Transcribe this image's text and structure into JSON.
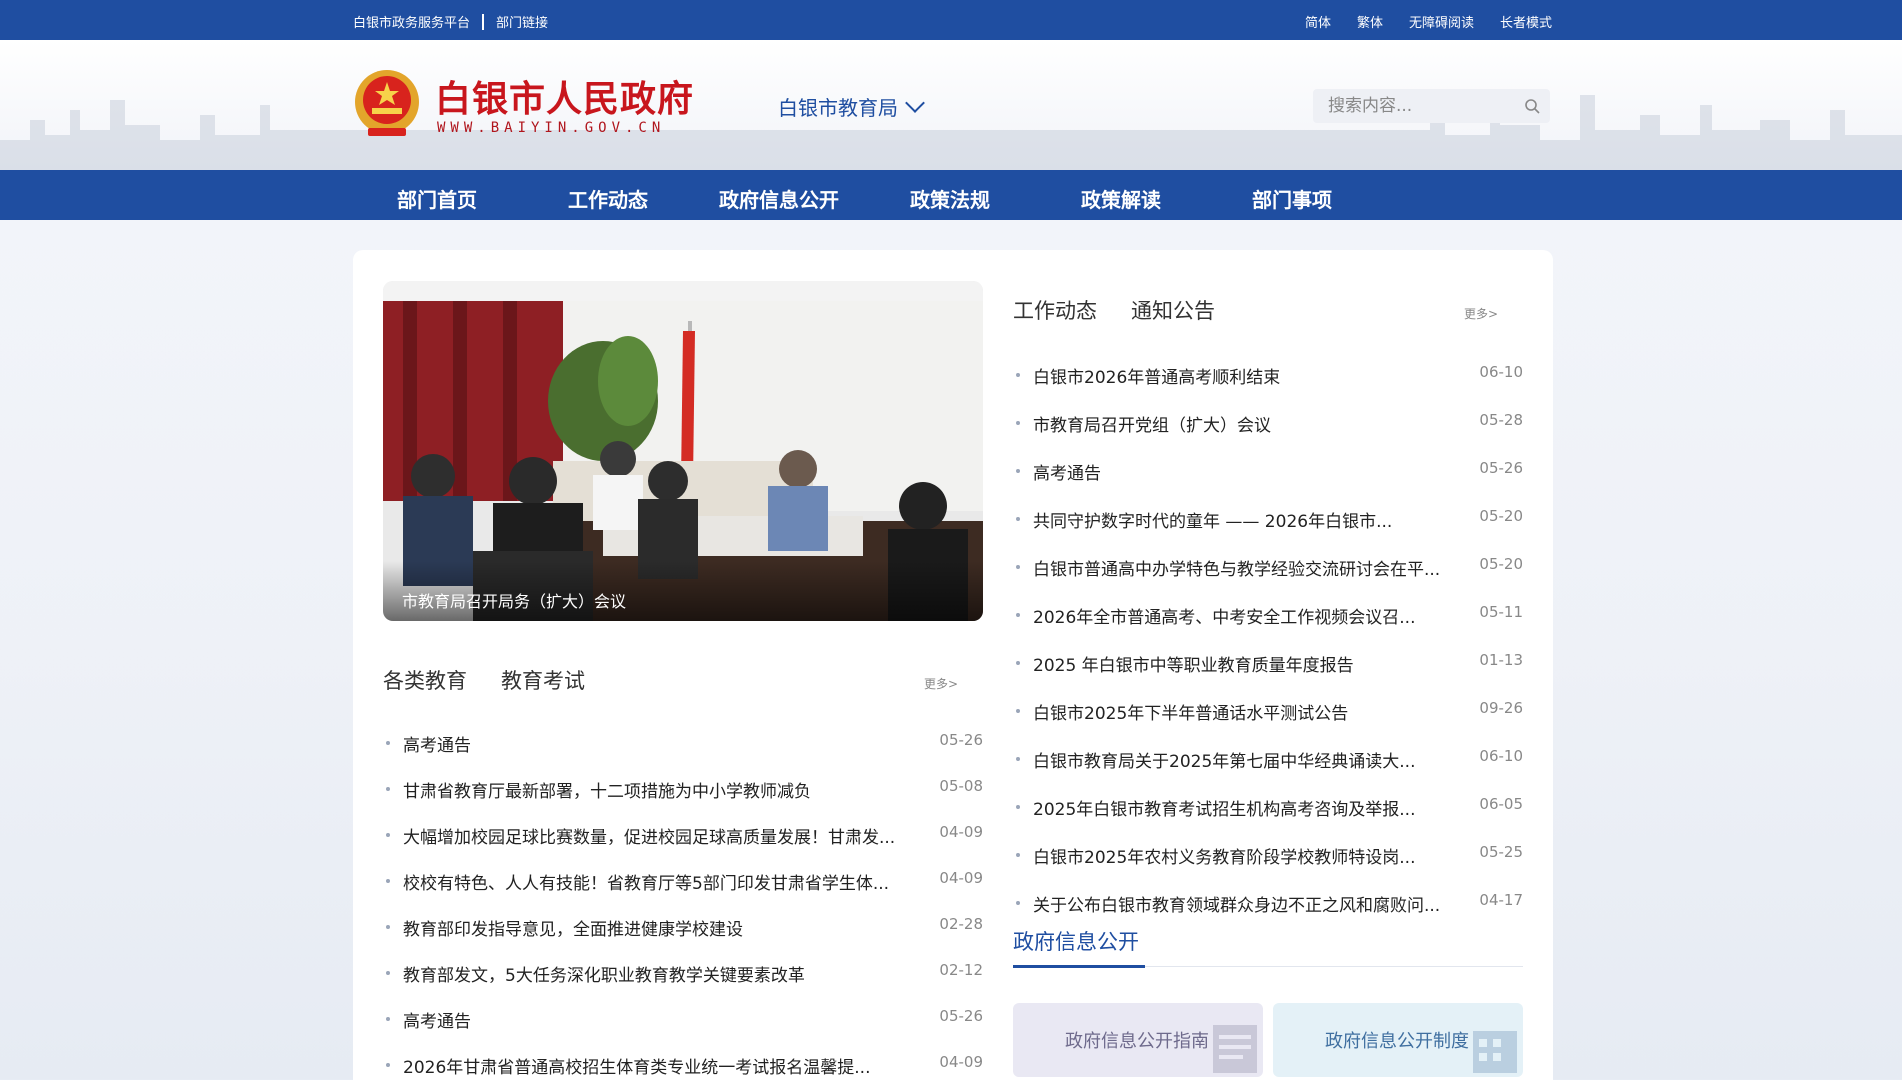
{
  "topbar": {
    "left_links": [
      "白银市政务服务平台",
      "部门链接"
    ],
    "right_links": [
      "简体",
      "繁体",
      "无障碍阅读",
      "长者模式"
    ]
  },
  "header": {
    "site_title": "白银市人民政府",
    "site_url": "WWW.BAIYIN.GOV.CN",
    "department": "白银市教育局",
    "search_placeholder": "搜索内容..."
  },
  "nav": {
    "items": [
      "部门首页",
      "工作动态",
      "政府信息公开",
      "政策法规",
      "政策解读",
      "部门事项"
    ]
  },
  "featured": {
    "caption": "市教育局召开局务（扩大）会议"
  },
  "education_section": {
    "tabs": [
      "各类教育",
      "教育考试"
    ],
    "more": "更多>",
    "items": [
      {
        "title": "高考通告",
        "date": "05-26"
      },
      {
        "title": "甘肃省教育厅最新部署，十二项措施为中小学教师减负",
        "date": "05-08"
      },
      {
        "title": "大幅增加校园足球比赛数量，促进校园足球高质量发展！甘肃发...",
        "date": "04-09"
      },
      {
        "title": "校校有特色、人人有技能！省教育厅等5部门印发甘肃省学生体...",
        "date": "04-09"
      },
      {
        "title": "教育部印发指导意见，全面推进健康学校建设",
        "date": "02-28"
      },
      {
        "title": "教育部发文，5大任务深化职业教育教学关键要素改革",
        "date": "02-12"
      },
      {
        "title": "高考通告",
        "date": "05-26"
      },
      {
        "title": "2026年甘肃省普通高校招生体育类专业统一考试报名温馨提...",
        "date": "04-09"
      }
    ]
  },
  "news_section": {
    "tabs": [
      "工作动态",
      "通知公告"
    ],
    "more": "更多>",
    "items": [
      {
        "title": "白银市2026年普通高考顺利结束",
        "date": "06-10"
      },
      {
        "title": "市教育局召开党组（扩大）会议",
        "date": "05-28"
      },
      {
        "title": "高考通告",
        "date": "05-26"
      },
      {
        "title": "共同守护数字时代的童年 —— 2026年白银市...",
        "date": "05-20"
      },
      {
        "title": "白银市普通高中办学特色与教学经验交流研讨会在平...",
        "date": "05-20"
      },
      {
        "title": "2026年全市普通高考、中考安全工作视频会议召...",
        "date": "05-11"
      },
      {
        "title": "2025 年白银市中等职业教育质量年度报告",
        "date": "01-13"
      },
      {
        "title": "白银市2025年下半年普通话水平测试公告",
        "date": "09-26"
      },
      {
        "title": "白银市教育局关于2025年第七届中华经典诵读大...",
        "date": "06-10"
      },
      {
        "title": "2025年白银市教育考试招生机构高考咨询及举报...",
        "date": "06-05"
      },
      {
        "title": "白银市2025年农村义务教育阶段学校教师特设岗...",
        "date": "05-25"
      },
      {
        "title": "关于公布白银市教育领域群众身边不正之风和腐败问...",
        "date": "04-17"
      }
    ]
  },
  "gov_info": {
    "heading": "政府信息公开",
    "buttons": [
      "政府信息公开指南",
      "政府信息公开制度"
    ]
  },
  "colors": {
    "primary_blue": "#1f4ea1",
    "brand_red": "#c8161d"
  }
}
